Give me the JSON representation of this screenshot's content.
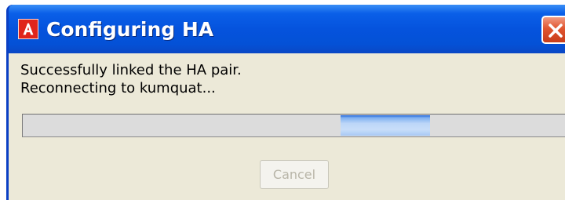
{
  "window": {
    "title": "Configuring HA",
    "icon": "alert-app-icon"
  },
  "message": {
    "line1": "Successfully linked the HA pair.",
    "line2": "Reconnecting to kumquat..."
  },
  "progress": {
    "indeterminate": true,
    "highlight_start_fraction": 0.57,
    "highlight_end_fraction": 0.73
  },
  "buttons": {
    "cancel_label": "Cancel",
    "cancel_enabled": false
  },
  "colors": {
    "titlebar": "#0553dd",
    "client_background": "#ece9d8",
    "progress_highlight": "#c8def9",
    "close_button": "#e0552f"
  }
}
